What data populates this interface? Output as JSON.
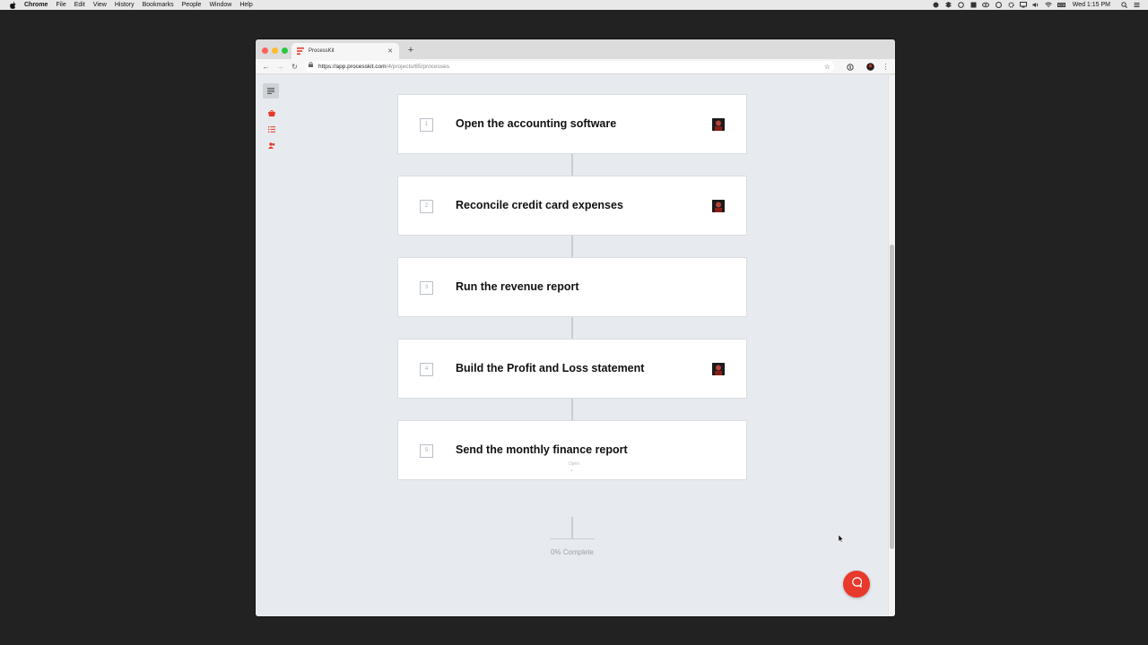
{
  "menubar": {
    "app": "Chrome",
    "items": [
      "File",
      "Edit",
      "View",
      "History",
      "Bookmarks",
      "People",
      "Window",
      "Help"
    ],
    "clock": "Wed 1:15 PM",
    "status_icons": [
      "skype-icon",
      "dropbox-icon",
      "record-icon",
      "grid-icon",
      "eye-icon",
      "globe-icon",
      "gear-icon",
      "display-icon",
      "volume-icon",
      "wifi-icon",
      "battery-icon"
    ]
  },
  "browser": {
    "tab_title": "ProcessKit",
    "url_host": "https://app.processkit.com",
    "url_path": "/4/projects/65/processes"
  },
  "colors": {
    "accent": "#e8392b",
    "page_bg": "#e7eaee",
    "card_bg": "#ffffff"
  },
  "steps": [
    {
      "number": "1",
      "title": "Open the accounting software",
      "has_assignee": true
    },
    {
      "number": "2",
      "title": "Reconcile credit card expenses",
      "has_assignee": true
    },
    {
      "number": "3",
      "title": "Run the revenue report",
      "has_assignee": false
    },
    {
      "number": "4",
      "title": "Build the Profit and Loss statement",
      "has_assignee": true
    },
    {
      "number": "5",
      "title": "Send the monthly finance report",
      "has_assignee": false
    }
  ],
  "open_hint": "Open",
  "progress": {
    "percent": 0,
    "label": "0% Complete"
  }
}
